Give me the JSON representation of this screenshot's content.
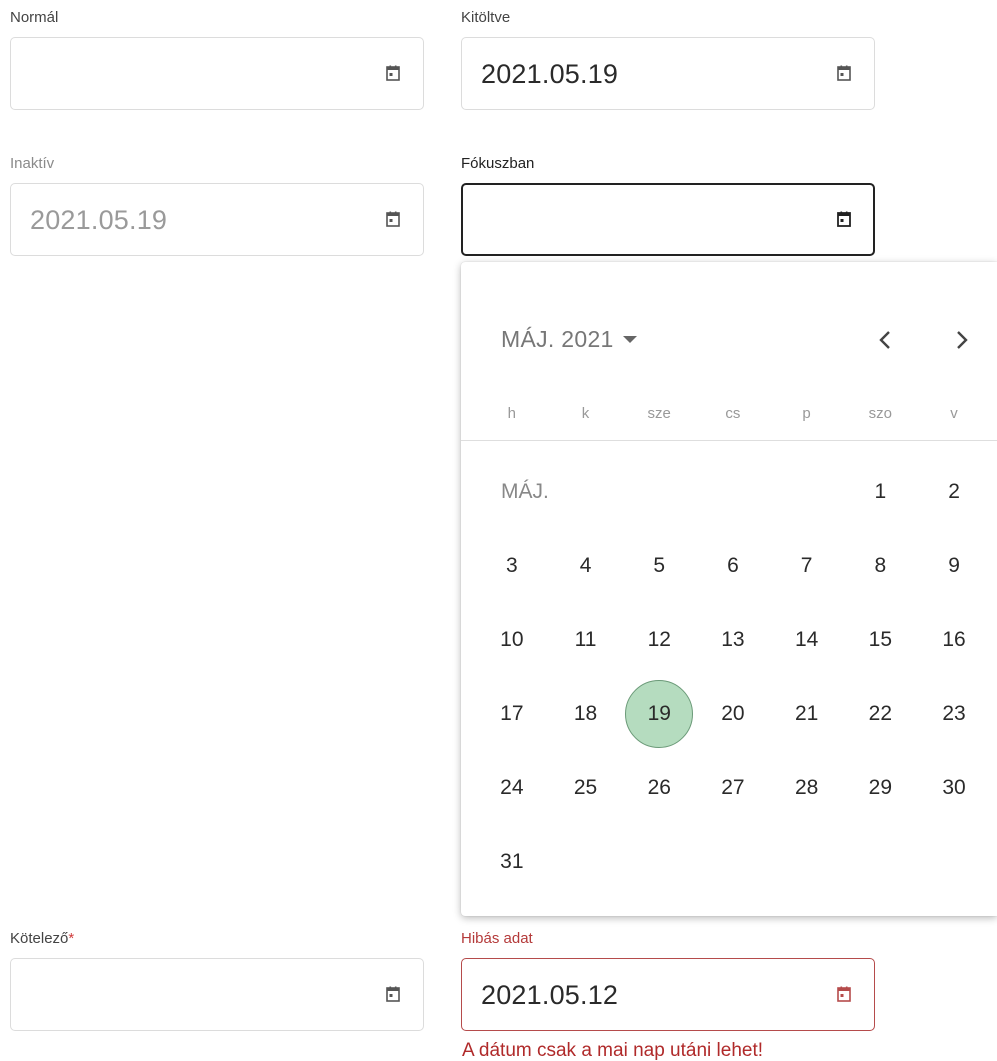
{
  "fields": {
    "normal": {
      "label": "Normál",
      "value": ""
    },
    "filled": {
      "label": "Kitöltve",
      "value": "2021.05.19"
    },
    "disabled": {
      "label": "Inaktív",
      "value": "2021.05.19"
    },
    "focused": {
      "label": "Fókuszban",
      "value": ""
    },
    "required": {
      "label": "Kötelező",
      "required_mark": "*",
      "value": ""
    },
    "error": {
      "label": "Hibás adat",
      "value": "2021.05.12",
      "error_message": "A dátum csak a mai nap utáni lehet!"
    }
  },
  "calendar": {
    "month_year_label": "MÁJ. 2021",
    "month_row_label": "MÁJ.",
    "weekdays": [
      "h",
      "k",
      "sze",
      "cs",
      "p",
      "szo",
      "v"
    ],
    "first_weekday_index": 5,
    "days_in_month": 31,
    "selected_day": 19,
    "days": [
      "1",
      "2",
      "3",
      "4",
      "5",
      "6",
      "7",
      "8",
      "9",
      "10",
      "11",
      "12",
      "13",
      "14",
      "15",
      "16",
      "17",
      "18",
      "19",
      "20",
      "21",
      "22",
      "23",
      "24",
      "25",
      "26",
      "27",
      "28",
      "29",
      "30",
      "31"
    ]
  },
  "colors": {
    "selected_day_bg": "#b5dcbf",
    "error": "#b02a2a",
    "focus_border": "#222222"
  }
}
